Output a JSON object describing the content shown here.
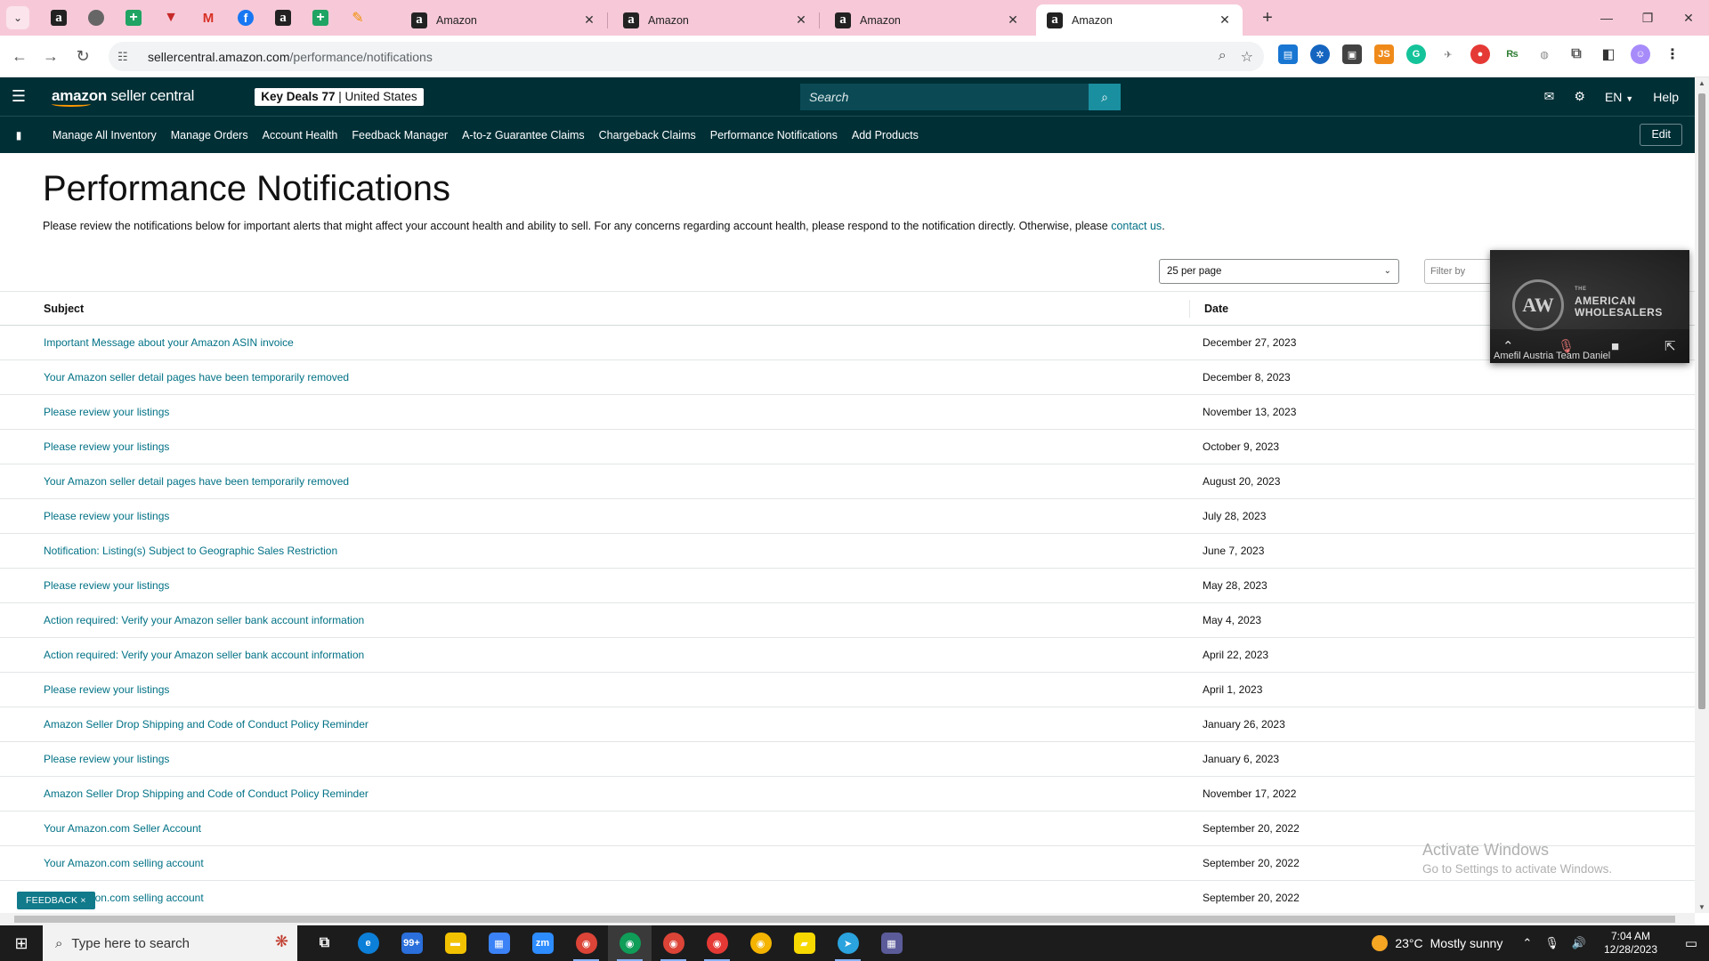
{
  "browser": {
    "pinned_tabs": [
      "amazon",
      "grey",
      "sheet",
      "red",
      "gmail",
      "fb",
      "amazon",
      "sheet",
      "pen"
    ],
    "tabs": [
      {
        "title": "Amazon"
      },
      {
        "title": "Amazon"
      },
      {
        "title": "Amazon"
      },
      {
        "title": "Amazon",
        "active": true
      }
    ],
    "url_host": "sellercentral.amazon.com",
    "url_path": "/performance/notifications"
  },
  "header": {
    "logo_prefix": "amazon",
    "logo_suffix": " seller central",
    "store_name": "Key Deals 77",
    "marketplace": "United States",
    "search_placeholder": "Search",
    "language": "EN",
    "help_label": "Help"
  },
  "nav": {
    "links": [
      "Manage All Inventory",
      "Manage Orders",
      "Account Health",
      "Feedback Manager",
      "A-to-z Guarantee Claims",
      "Chargeback Claims",
      "Performance Notifications",
      "Add Products"
    ],
    "edit_label": "Edit"
  },
  "page": {
    "title": "Performance Notifications",
    "description": "Please review the notifications below for important alerts that might affect your account health and ability to sell. For any concerns regarding account health, please respond to the notification directly. Otherwise, please ",
    "contact_link": "contact us",
    "description_end": ".",
    "per_page": "25 per page",
    "filter_placeholder": "Filter by"
  },
  "table": {
    "columns": [
      "Subject",
      "Date"
    ],
    "rows": [
      {
        "subject": "Important Message about your Amazon ASIN invoice",
        "date": "December 27, 2023"
      },
      {
        "subject": "Your Amazon seller detail pages have been temporarily removed",
        "date": "December 8, 2023"
      },
      {
        "subject": "Please review your listings",
        "date": "November 13, 2023"
      },
      {
        "subject": "Please review your listings",
        "date": "October 9, 2023"
      },
      {
        "subject": "Your Amazon seller detail pages have been temporarily removed",
        "date": "August 20, 2023"
      },
      {
        "subject": "Please review your listings",
        "date": "July 28, 2023"
      },
      {
        "subject": "Notification: Listing(s) Subject to Geographic Sales Restriction",
        "date": "June 7, 2023"
      },
      {
        "subject": "Please review your listings",
        "date": "May 28, 2023"
      },
      {
        "subject": "Action required: Verify your Amazon seller bank account information",
        "date": "May 4, 2023"
      },
      {
        "subject": "Action required: Verify your Amazon seller bank account information",
        "date": "April 22, 2023"
      },
      {
        "subject": "Please review your listings",
        "date": "April 1, 2023"
      },
      {
        "subject": "Amazon Seller Drop Shipping and Code of Conduct Policy Reminder",
        "date": "January 26, 2023"
      },
      {
        "subject": "Please review your listings",
        "date": "January 6, 2023"
      },
      {
        "subject": "Amazon Seller Drop Shipping and Code of Conduct Policy Reminder",
        "date": "November 17, 2022"
      },
      {
        "subject": "Your Amazon.com Seller Account",
        "date": "September 20, 2022"
      },
      {
        "subject": "Your Amazon.com selling account",
        "date": "September 20, 2022"
      },
      {
        "subject": "Your Amazon.com selling account",
        "date": "September 20, 2022"
      }
    ]
  },
  "feedback_label": "FEEDBACK ×",
  "video_overlay": {
    "emblem": "AW",
    "brand_small": "THE",
    "brand_line1": "AMERICAN",
    "brand_line2": "WHOLESALERS",
    "participant": "Amefil Austria Team Daniel"
  },
  "watermark": {
    "line1": "Activate Windows",
    "line2": "Go to Settings to activate Windows."
  },
  "taskbar": {
    "search_placeholder": "Type here to search",
    "badge_mail": "99+",
    "weather_temp": "23°C",
    "weather_desc": "Mostly sunny",
    "time": "7:04 AM",
    "date": "12/28/2023"
  },
  "colors": {
    "header_bg": "#002f36",
    "link": "#007185",
    "tabstrip_bg": "#f7c9d8",
    "search_btn": "#1a8fa0"
  }
}
